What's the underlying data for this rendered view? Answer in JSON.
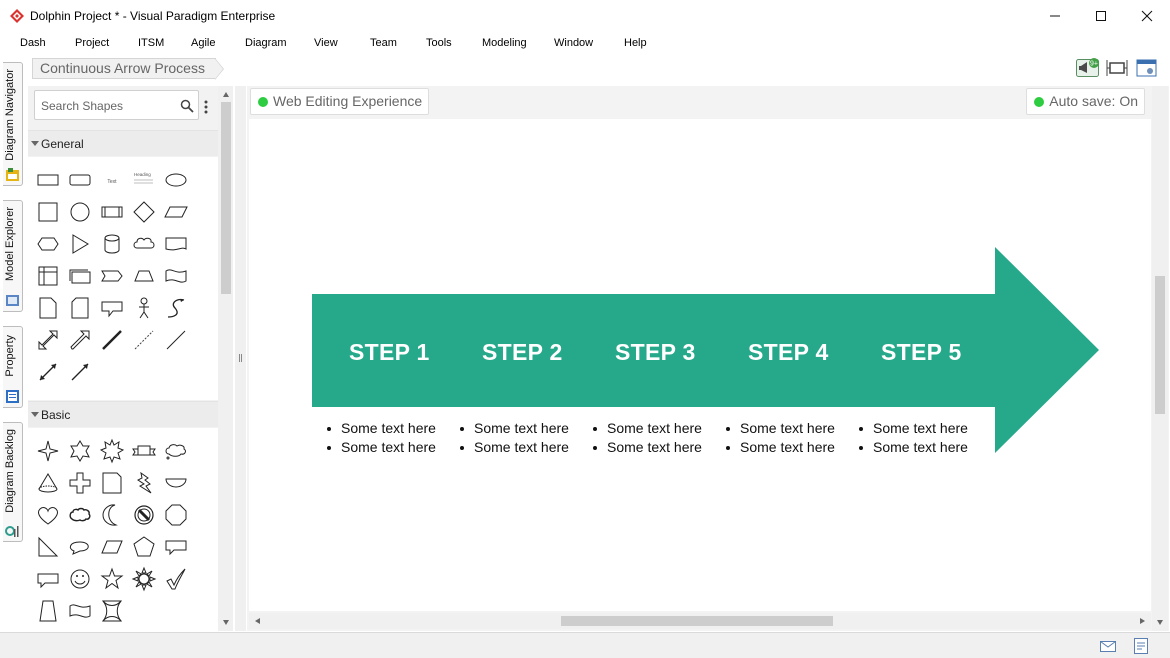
{
  "window": {
    "title": "Dolphin Project * - Visual Paradigm Enterprise",
    "minimize": "—",
    "maximize": "☐",
    "close": "✕"
  },
  "menu": [
    "Dash",
    "Project",
    "ITSM",
    "Agile",
    "Diagram",
    "View",
    "Team",
    "Tools",
    "Modeling",
    "Window",
    "Help"
  ],
  "side_tabs": [
    "Diagram Navigator",
    "Model Explorer",
    "Property",
    "Diagram Backlog"
  ],
  "breadcrumb": "Continuous Arrow Process",
  "notification_badge": "9+",
  "shapes_panel": {
    "search_placeholder": "Search Shapes",
    "sections": [
      "General",
      "Basic"
    ],
    "general_text_shape": "Text",
    "general_heading_shape": "Heading"
  },
  "canvas": {
    "mode_label": "Web Editing Experience",
    "autosave_label": "Auto save: On",
    "arrow_color": "#26a98b",
    "steps": [
      "STEP 1",
      "STEP 2",
      "STEP 3",
      "STEP 4",
      "STEP 5"
    ],
    "bullets": [
      [
        "Some text here",
        "Some text here"
      ],
      [
        "Some text here",
        "Some text here"
      ],
      [
        "Some text here",
        "Some text here"
      ],
      [
        "Some text here",
        "Some text here"
      ],
      [
        "Some text here",
        "Some text here"
      ]
    ]
  }
}
